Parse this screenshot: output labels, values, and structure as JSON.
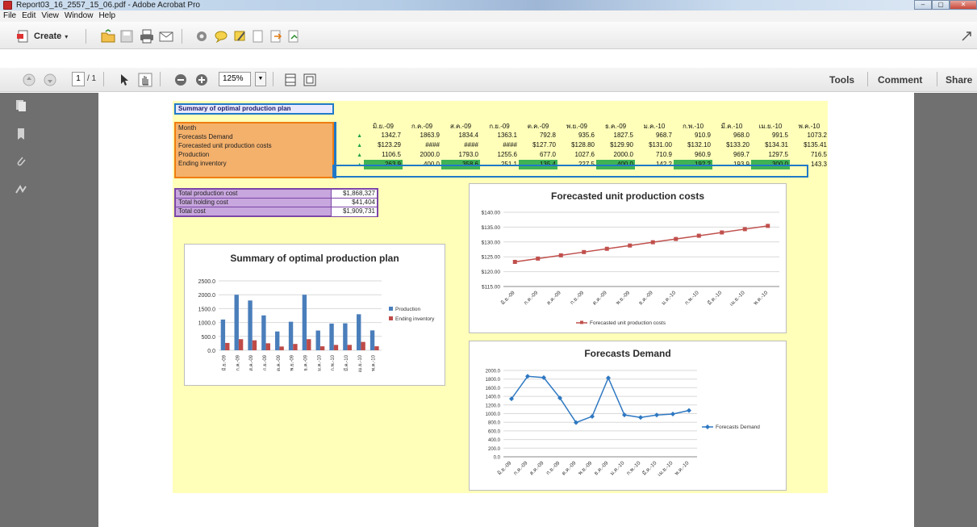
{
  "window": {
    "title": "Report03_16_2557_15_06.pdf - Adobe Acrobat Pro"
  },
  "menu": [
    "File",
    "Edit",
    "View",
    "Window",
    "Help"
  ],
  "toolbar": {
    "create_label": "Create"
  },
  "navigation": {
    "current_page": "1",
    "page_count": "/ 1",
    "zoom": "125%"
  },
  "panels": {
    "tools": "Tools",
    "comment": "Comment",
    "share": "Share"
  },
  "sheet": {
    "title": "Summary of optimal production plan",
    "row_labels": [
      "Month",
      "Forecasts Demand",
      "Forecasted unit production costs",
      "Production",
      "Ending inventory"
    ],
    "months": [
      "มิ.ย.-09",
      "ก.ค.-09",
      "ส.ค.-09",
      "ก.ย.-09",
      "ต.ค.-09",
      "พ.ย.-09",
      "ธ.ค.-09",
      "ม.ค.-10",
      "ก.พ.-10",
      "มี.ค.-10",
      "เม.ย.-10",
      "พ.ค.-10"
    ],
    "forecast_demand": [
      "1342.7",
      "1863.9",
      "1834.4",
      "1363.1",
      "792.8",
      "935.6",
      "1827.5",
      "968.7",
      "910.9",
      "968.0",
      "991.5",
      "1073.2"
    ],
    "unit_costs": [
      "$123.29",
      "####",
      "####",
      "####",
      "$127.70",
      "$128.80",
      "$129.90",
      "$131.00",
      "$132.10",
      "$133.20",
      "$134.31",
      "$135.41"
    ],
    "production": [
      "1106.5",
      "2000.0",
      "1793.0",
      "1255.6",
      "677.0",
      "1027.6",
      "2000.0",
      "710.9",
      "960.9",
      "969.7",
      "1297.5",
      "716.5"
    ],
    "ending_inventory": [
      "263.9",
      "400.0",
      "358.6",
      "251.1",
      "135.4",
      "227.5",
      "400.0",
      "142.2",
      "192.2",
      "193.9",
      "300.0",
      "143.3"
    ],
    "totals": [
      {
        "label": "Total production cost",
        "value": "$1,868,327"
      },
      {
        "label": "Total holding cost",
        "value": "$41,404"
      },
      {
        "label": "Total cost",
        "value": "$1,909,731"
      }
    ]
  },
  "chart_data": [
    {
      "type": "bar",
      "title": "Summary of optimal production plan",
      "categories": [
        "มิ.ย.-09",
        "ก.ค.-09",
        "ส.ค.-09",
        "ก.ย.-09",
        "ต.ค.-09",
        "พ.ย.-09",
        "ธ.ค.-09",
        "ม.ค.-10",
        "ก.พ.-10",
        "มี.ค.-10",
        "เม.ย.-10",
        "พ.ค.-10"
      ],
      "series": [
        {
          "name": "Production",
          "values": [
            1106.5,
            2000.0,
            1793.0,
            1255.6,
            677.0,
            1027.6,
            2000.0,
            710.9,
            960.9,
            969.7,
            1297.5,
            716.5
          ],
          "color": "#4a7ebb"
        },
        {
          "name": "Ending inventory",
          "values": [
            263.9,
            400.0,
            358.6,
            251.1,
            135.4,
            227.5,
            400.0,
            142.2,
            192.2,
            193.9,
            300.0,
            143.3
          ],
          "color": "#be4b48"
        }
      ],
      "ylim": [
        0,
        2500
      ],
      "yticks": [
        "0.0",
        "500.0",
        "1000.0",
        "1500.0",
        "2000.0",
        "2500.0"
      ],
      "grid": true,
      "legend": "right"
    },
    {
      "type": "line",
      "title": "Forecasted unit production costs",
      "categories": [
        "มิ.ย.-09",
        "ก.ค.-09",
        "ส.ค.-09",
        "ก.ย.-09",
        "ต.ค.-09",
        "พ.ย.-09",
        "ธ.ค.-09",
        "ม.ค.-10",
        "ก.พ.-10",
        "มี.ค.-10",
        "เม.ย.-10",
        "พ.ค.-10"
      ],
      "series": [
        {
          "name": "Forecasted unit production costs",
          "values": [
            123.29,
            124.4,
            125.5,
            126.6,
            127.7,
            128.8,
            129.9,
            131.0,
            132.1,
            133.2,
            134.31,
            135.41
          ],
          "color": "#c0504d"
        }
      ],
      "ylim": [
        115,
        140
      ],
      "yticks": [
        "$115.00",
        "$120.00",
        "$125.00",
        "$130.00",
        "$135.00",
        "$140.00"
      ],
      "grid": true,
      "legend": "bottom"
    },
    {
      "type": "line",
      "title": "Forecasts Demand",
      "categories": [
        "มิ.ย.-09",
        "ก.ค.-09",
        "ส.ค.-09",
        "ก.ย.-09",
        "ต.ค.-09",
        "พ.ย.-09",
        "ธ.ค.-09",
        "ม.ค.-10",
        "ก.พ.-10",
        "มี.ค.-10",
        "เม.ย.-10",
        "พ.ค.-10"
      ],
      "series": [
        {
          "name": "Forecasts Demand",
          "values": [
            1342.7,
            1863.9,
            1834.4,
            1363.1,
            792.8,
            935.6,
            1827.5,
            968.7,
            910.9,
            968.0,
            991.5,
            1073.2
          ],
          "color": "#2e78c2"
        }
      ],
      "ylim": [
        0,
        2000
      ],
      "yticks": [
        "0.0",
        "200.0",
        "400.0",
        "600.0",
        "800.0",
        "1000.0",
        "1200.0",
        "1400.0",
        "1600.0",
        "1800.0",
        "2000.0"
      ],
      "grid": true,
      "legend": "right"
    }
  ]
}
